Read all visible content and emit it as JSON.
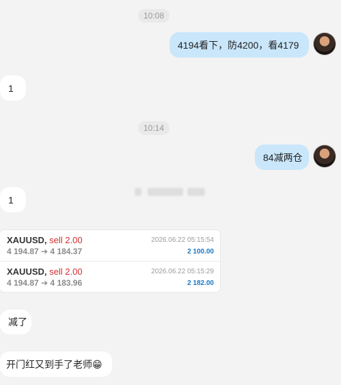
{
  "chat": {
    "time1": "10:08",
    "msg_out_1": "4194看下，防4200，看4179",
    "msg_in_1": "1",
    "time2": "10:14",
    "msg_out_2": "84减两仓",
    "msg_in_2": "1",
    "msg_in_3": "减了",
    "msg_in_4": "开门红又到手了老师😁"
  },
  "trades": [
    {
      "symbol": "XAUUSD,",
      "side": "sell 2.00",
      "prices": "4 194.87 ➔ 4 184.37",
      "datetime": "2026.06.22 05:15:54",
      "profit": "2 100.00"
    },
    {
      "symbol": "XAUUSD,",
      "side": "sell 2.00",
      "prices": "4 194.87 ➔ 4 183.96",
      "datetime": "2026.06.22 05:15:29",
      "profit": "2 182.00"
    }
  ],
  "colors": {
    "background": "#f3f3f3",
    "outgoing_bubble": "#c9e6fb",
    "incoming_bubble": "#ffffff",
    "sell": "#d62b2b",
    "profit": "#1a76c8"
  }
}
